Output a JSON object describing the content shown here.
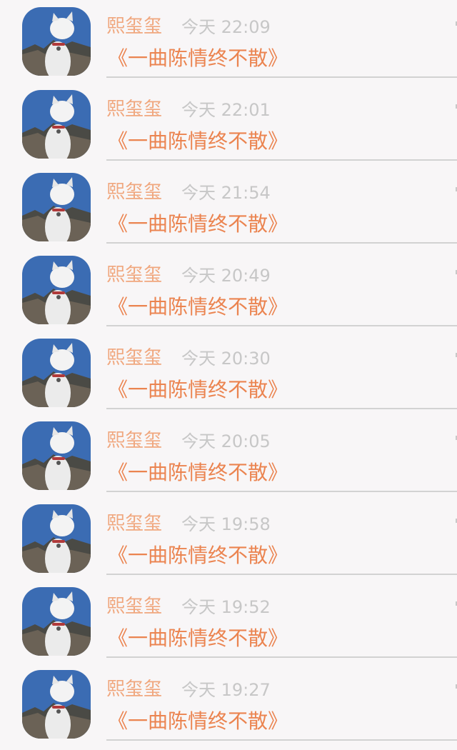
{
  "feed": {
    "items": [
      {
        "name": "熙玺玺",
        "time": "今天 22:09",
        "message": "《一曲陈情终不散》",
        "avatar_icon": "cat-photo-avatar-icon"
      },
      {
        "name": "熙玺玺",
        "time": "今天 22:01",
        "message": "《一曲陈情终不散》",
        "avatar_icon": "cat-photo-avatar-icon"
      },
      {
        "name": "熙玺玺",
        "time": "今天 21:54",
        "message": "《一曲陈情终不散》",
        "avatar_icon": "cat-photo-avatar-icon"
      },
      {
        "name": "熙玺玺",
        "time": "今天 20:49",
        "message": "《一曲陈情终不散》",
        "avatar_icon": "cat-photo-avatar-icon"
      },
      {
        "name": "熙玺玺",
        "time": "今天 20:30",
        "message": "《一曲陈情终不散》",
        "avatar_icon": "cat-photo-avatar-icon"
      },
      {
        "name": "熙玺玺",
        "time": "今天 20:05",
        "message": "《一曲陈情终不散》",
        "avatar_icon": "cat-photo-avatar-icon"
      },
      {
        "name": "熙玺玺",
        "time": "今天 19:58",
        "message": "《一曲陈情终不散》",
        "avatar_icon": "cat-photo-avatar-icon"
      },
      {
        "name": "熙玺玺",
        "time": "今天 19:52",
        "message": "《一曲陈情终不散》",
        "avatar_icon": "cat-photo-avatar-icon"
      },
      {
        "name": "熙玺玺",
        "time": "今天 19:27",
        "message": "《一曲陈情终不散》",
        "avatar_icon": "cat-photo-avatar-icon"
      }
    ]
  },
  "colors": {
    "background": "#f8f6f7",
    "name": "#f0a77e",
    "time": "#c7c7c7",
    "message": "#eb8450",
    "divider": "#d2d2d2"
  }
}
